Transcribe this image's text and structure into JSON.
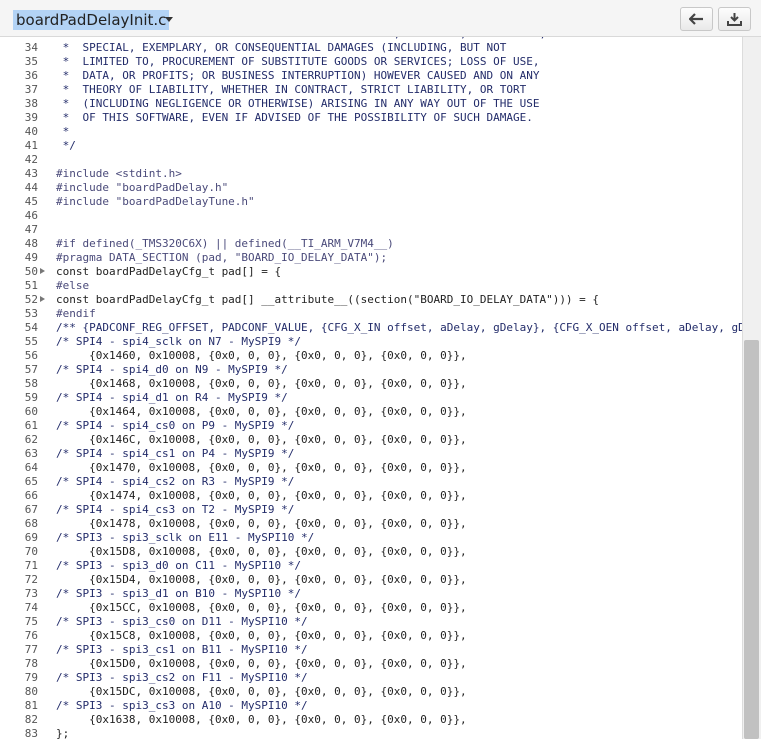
{
  "file": {
    "name": "boardPadDelayInit.c"
  },
  "lines": [
    {
      "n": "33",
      "t": "     OWNER OR CONTRIBUTORS BE LIABLE FOR ANY DIRECT, INDIRECT, INCIDENTAL,",
      "k": "comment"
    },
    {
      "n": "34",
      "t": " *  SPECIAL, EXEMPLARY, OR CONSEQUENTIAL DAMAGES (INCLUDING, BUT NOT",
      "k": "comment"
    },
    {
      "n": "35",
      "t": " *  LIMITED TO, PROCUREMENT OF SUBSTITUTE GOODS OR SERVICES; LOSS OF USE,",
      "k": "comment"
    },
    {
      "n": "36",
      "t": " *  DATA, OR PROFITS; OR BUSINESS INTERRUPTION) HOWEVER CAUSED AND ON ANY",
      "k": "comment"
    },
    {
      "n": "37",
      "t": " *  THEORY OF LIABILITY, WHETHER IN CONTRACT, STRICT LIABILITY, OR TORT",
      "k": "comment"
    },
    {
      "n": "38",
      "t": " *  (INCLUDING NEGLIGENCE OR OTHERWISE) ARISING IN ANY WAY OUT OF THE USE",
      "k": "comment"
    },
    {
      "n": "39",
      "t": " *  OF THIS SOFTWARE, EVEN IF ADVISED OF THE POSSIBILITY OF SUCH DAMAGE.",
      "k": "comment"
    },
    {
      "n": "40",
      "t": " *",
      "k": "comment"
    },
    {
      "n": "41",
      "t": " */",
      "k": "comment"
    },
    {
      "n": "42",
      "t": "",
      "k": "plain"
    },
    {
      "n": "43",
      "t": "#include <stdint.h>",
      "k": "pre"
    },
    {
      "n": "44",
      "t": "#include \"boardPadDelay.h\"",
      "k": "pre"
    },
    {
      "n": "45",
      "t": "#include \"boardPadDelayTune.h\"",
      "k": "pre"
    },
    {
      "n": "46",
      "t": "",
      "k": "plain"
    },
    {
      "n": "47",
      "t": "",
      "k": "plain"
    },
    {
      "n": "48",
      "t": "#if defined(_TMS320C6X) || defined(__TI_ARM_V7M4__)",
      "k": "pre"
    },
    {
      "n": "49",
      "t": "#pragma DATA_SECTION (pad, \"BOARD_IO_DELAY_DATA\");",
      "k": "pre"
    },
    {
      "n": "50",
      "t": "const boardPadDelayCfg_t pad[] = {",
      "k": "plain",
      "fold": true
    },
    {
      "n": "51",
      "t": "#else",
      "k": "pre"
    },
    {
      "n": "52",
      "t": "const boardPadDelayCfg_t pad[] __attribute__((section(\"BOARD_IO_DELAY_DATA\"))) = {",
      "k": "plain",
      "fold": true
    },
    {
      "n": "53",
      "t": "#endif",
      "k": "pre"
    },
    {
      "n": "54",
      "t": "/** {PADCONF_REG_OFFSET, PADCONF_VALUE, {CFG_X_IN offset, aDelay, gDelay}, {CFG_X_OEN offset, aDelay, gDelay}, {CFG_X_OUT offset, aDelay, gDelay}} */",
      "k": "comment"
    },
    {
      "n": "55",
      "t": "/* SPI4 - spi4_sclk on N7 - MySPI9 */",
      "k": "comment"
    },
    {
      "n": "56",
      "t": "     {0x1460, 0x10008, {0x0, 0, 0}, {0x0, 0, 0}, {0x0, 0, 0}},",
      "k": "plain"
    },
    {
      "n": "57",
      "t": "/* SPI4 - spi4_d0 on N9 - MySPI9 */",
      "k": "comment"
    },
    {
      "n": "58",
      "t": "     {0x1468, 0x10008, {0x0, 0, 0}, {0x0, 0, 0}, {0x0, 0, 0}},",
      "k": "plain"
    },
    {
      "n": "59",
      "t": "/* SPI4 - spi4_d1 on R4 - MySPI9 */",
      "k": "comment"
    },
    {
      "n": "60",
      "t": "     {0x1464, 0x10008, {0x0, 0, 0}, {0x0, 0, 0}, {0x0, 0, 0}},",
      "k": "plain"
    },
    {
      "n": "61",
      "t": "/* SPI4 - spi4_cs0 on P9 - MySPI9 */",
      "k": "comment"
    },
    {
      "n": "62",
      "t": "     {0x146C, 0x10008, {0x0, 0, 0}, {0x0, 0, 0}, {0x0, 0, 0}},",
      "k": "plain"
    },
    {
      "n": "63",
      "t": "/* SPI4 - spi4_cs1 on P4 - MySPI9 */",
      "k": "comment"
    },
    {
      "n": "64",
      "t": "     {0x1470, 0x10008, {0x0, 0, 0}, {0x0, 0, 0}, {0x0, 0, 0}},",
      "k": "plain"
    },
    {
      "n": "65",
      "t": "/* SPI4 - spi4_cs2 on R3 - MySPI9 */",
      "k": "comment"
    },
    {
      "n": "66",
      "t": "     {0x1474, 0x10008, {0x0, 0, 0}, {0x0, 0, 0}, {0x0, 0, 0}},",
      "k": "plain"
    },
    {
      "n": "67",
      "t": "/* SPI4 - spi4_cs3 on T2 - MySPI9 */",
      "k": "comment"
    },
    {
      "n": "68",
      "t": "     {0x1478, 0x10008, {0x0, 0, 0}, {0x0, 0, 0}, {0x0, 0, 0}},",
      "k": "plain"
    },
    {
      "n": "69",
      "t": "/* SPI3 - spi3_sclk on E11 - MySPI10 */",
      "k": "comment"
    },
    {
      "n": "70",
      "t": "     {0x15D8, 0x10008, {0x0, 0, 0}, {0x0, 0, 0}, {0x0, 0, 0}},",
      "k": "plain"
    },
    {
      "n": "71",
      "t": "/* SPI3 - spi3_d0 on C11 - MySPI10 */",
      "k": "comment"
    },
    {
      "n": "72",
      "t": "     {0x15D4, 0x10008, {0x0, 0, 0}, {0x0, 0, 0}, {0x0, 0, 0}},",
      "k": "plain"
    },
    {
      "n": "73",
      "t": "/* SPI3 - spi3_d1 on B10 - MySPI10 */",
      "k": "comment"
    },
    {
      "n": "74",
      "t": "     {0x15CC, 0x10008, {0x0, 0, 0}, {0x0, 0, 0}, {0x0, 0, 0}},",
      "k": "plain"
    },
    {
      "n": "75",
      "t": "/* SPI3 - spi3_cs0 on D11 - MySPI10 */",
      "k": "comment"
    },
    {
      "n": "76",
      "t": "     {0x15C8, 0x10008, {0x0, 0, 0}, {0x0, 0, 0}, {0x0, 0, 0}},",
      "k": "plain"
    },
    {
      "n": "77",
      "t": "/* SPI3 - spi3_cs1 on B11 - MySPI10 */",
      "k": "comment"
    },
    {
      "n": "78",
      "t": "     {0x15D0, 0x10008, {0x0, 0, 0}, {0x0, 0, 0}, {0x0, 0, 0}},",
      "k": "plain"
    },
    {
      "n": "79",
      "t": "/* SPI3 - spi3_cs2 on F11 - MySPI10 */",
      "k": "comment"
    },
    {
      "n": "80",
      "t": "     {0x15DC, 0x10008, {0x0, 0, 0}, {0x0, 0, 0}, {0x0, 0, 0}},",
      "k": "plain"
    },
    {
      "n": "81",
      "t": "/* SPI3 - spi3_cs3 on A10 - MySPI10 */",
      "k": "comment"
    },
    {
      "n": "82",
      "t": "     {0x1638, 0x10008, {0x0, 0, 0}, {0x0, 0, 0}, {0x0, 0, 0}},",
      "k": "plain"
    },
    {
      "n": "83",
      "t": "};",
      "k": "plain"
    }
  ],
  "icons": {
    "back": "arrow-left-icon",
    "download": "download-icon",
    "dropdown": "chevron-down-icon",
    "fold": "fold-arrow-icon"
  },
  "colors": {
    "selection": "#b3d3f5",
    "comment": "#232c6a",
    "preprocessor": "#4a4a7a"
  }
}
